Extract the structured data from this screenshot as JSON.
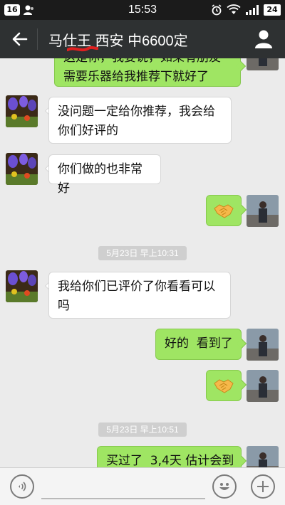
{
  "status_bar": {
    "left_badge": "16",
    "time": "15:53",
    "battery": "24"
  },
  "header": {
    "title": "马仕王 西安 中6600定"
  },
  "messages": [
    {
      "side": "out",
      "text_lines": [
        "这是你，我要说，如果有朋友",
        "需要乐器给我推荐下就好了"
      ]
    },
    {
      "side": "in",
      "text_lines": [
        "没问题一定给你推荐，我会给",
        "你们好评的"
      ]
    },
    {
      "side": "in",
      "text_lines": [
        "你们做的也非常好"
      ]
    },
    {
      "side": "out",
      "emoji": "handshake"
    },
    {
      "type": "timestamp",
      "text": "5月23日 早上10:31"
    },
    {
      "side": "in",
      "text_lines": [
        "我给你们已评价了你看看可以",
        "吗"
      ]
    },
    {
      "side": "out",
      "text_lines": [
        "好的  看到了"
      ]
    },
    {
      "side": "out",
      "emoji": "handshake"
    },
    {
      "type": "timestamp",
      "text": "5月23日 早上10:51"
    },
    {
      "side": "out",
      "text_lines": [
        "买过了  3,4天 估计会到"
      ]
    }
  ],
  "bottom": {
    "input_placeholder": "",
    "icons": [
      "voice-icon",
      "smiley-icon",
      "plus-icon"
    ]
  },
  "colors": {
    "status_bar": "#1b1b1b",
    "title_bar": "#2e3132",
    "background": "#ebebeb",
    "bubble_out": "#9fe563",
    "bubble_in": "#ffffff",
    "timestamp_bg": "#cfcfcf"
  }
}
